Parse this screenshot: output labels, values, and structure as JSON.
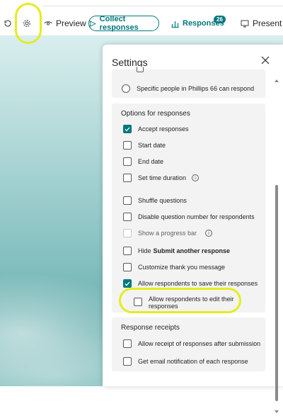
{
  "toolbar": {
    "preview_label": "Preview",
    "collect_label": "Collect responses",
    "responses_label": "Responses",
    "responses_count": "26",
    "present_label": "Present"
  },
  "settings": {
    "title": "Settings",
    "specific_people": "Specific people in Phillips 66 can respond",
    "options_header": "Options for responses",
    "options": {
      "accept": "Accept responses",
      "start_date": "Start date",
      "end_date": "End date",
      "set_time": "Set time duration",
      "shuffle": "Shuffle questions",
      "disable_numbers": "Disable question number for respondents",
      "progress_bar": "Show a progress bar",
      "hide_prefix": "Hide",
      "hide_bold": "Submit another response",
      "customize": "Customize thank you message",
      "allow_save": "Allow respondents to save their responses",
      "allow_edit": "Allow respondents to edit their responses"
    },
    "receipts_header": "Response receipts",
    "receipts": {
      "allow_receipt": "Allow receipt of responses after submission",
      "email_notify": "Get email notification of each response"
    }
  },
  "colors": {
    "accent": "#03787c",
    "highlight": "#e5ec1f"
  }
}
